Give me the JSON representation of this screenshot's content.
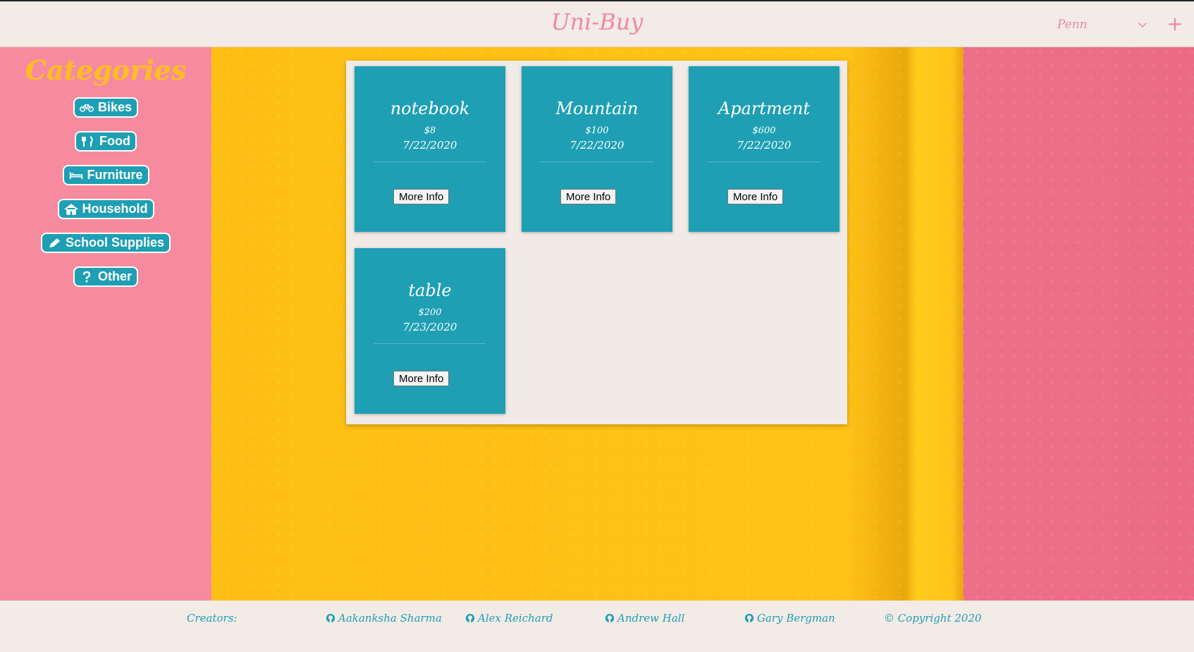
{
  "header": {
    "brand": "Uni-Buy",
    "school": "Penn",
    "add_label": "+"
  },
  "sidebar": {
    "title": "Categories",
    "items": [
      {
        "label": "Bikes",
        "icon": "bicycle-icon"
      },
      {
        "label": "Food",
        "icon": "utensils-icon"
      },
      {
        "label": "Furniture",
        "icon": "bed-icon"
      },
      {
        "label": "Household",
        "icon": "home-icon"
      },
      {
        "label": "School Supplies",
        "icon": "pencil-icon"
      },
      {
        "label": "Other",
        "icon": "question-icon"
      }
    ]
  },
  "listings": [
    {
      "title": "notebook",
      "price": "$8",
      "date": "7/22/2020",
      "button": "More Info"
    },
    {
      "title": "Mountain",
      "price": "$100",
      "date": "7/22/2020",
      "button": "More Info"
    },
    {
      "title": "Apartment",
      "price": "$600",
      "date": "7/22/2020",
      "button": "More Info"
    },
    {
      "title": "table",
      "price": "$200",
      "date": "7/23/2020",
      "button": "More Info"
    }
  ],
  "footer": {
    "creators_label": "Creators:",
    "creators": [
      "Aakanksha Sharma",
      "Alex Reichard",
      "Andrew Hall",
      "Gary Bergman"
    ],
    "copyright": "© Copyright 2020"
  },
  "colors": {
    "teal": "#1e9fb4",
    "pink": "#f68ba0",
    "yellow": "#ffc216",
    "cream": "#f1ebe6"
  }
}
